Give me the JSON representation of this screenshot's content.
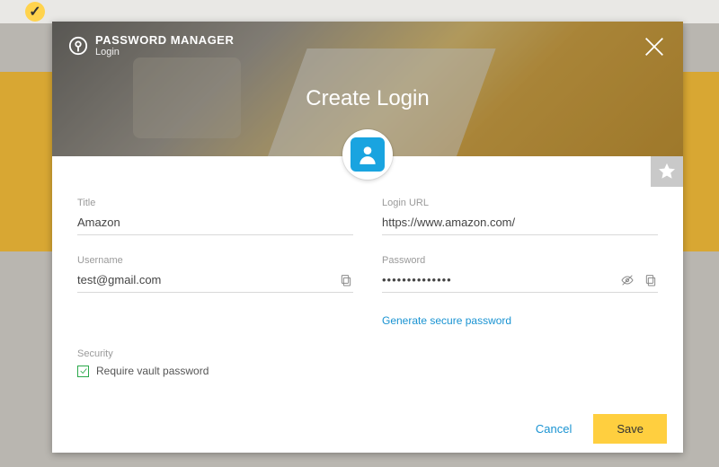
{
  "brand": {
    "name": "PASSWORD MANAGER",
    "section": "Login"
  },
  "hero": {
    "title": "Create Login"
  },
  "fields": {
    "title": {
      "label": "Title",
      "value": "Amazon"
    },
    "loginUrl": {
      "label": "Login URL",
      "value": "https://www.amazon.com/"
    },
    "username": {
      "label": "Username",
      "value": "test@gmail.com"
    },
    "password": {
      "label": "Password",
      "value": "••••••••••••••"
    }
  },
  "links": {
    "generate": "Generate secure password"
  },
  "security": {
    "label": "Security",
    "requireVault": "Require vault password",
    "checked": true
  },
  "actions": {
    "cancel": "Cancel",
    "save": "Save"
  },
  "colors": {
    "accent": "#1993d2",
    "saveButton": "#ffcf3f",
    "avatar": "#19a4e0"
  }
}
